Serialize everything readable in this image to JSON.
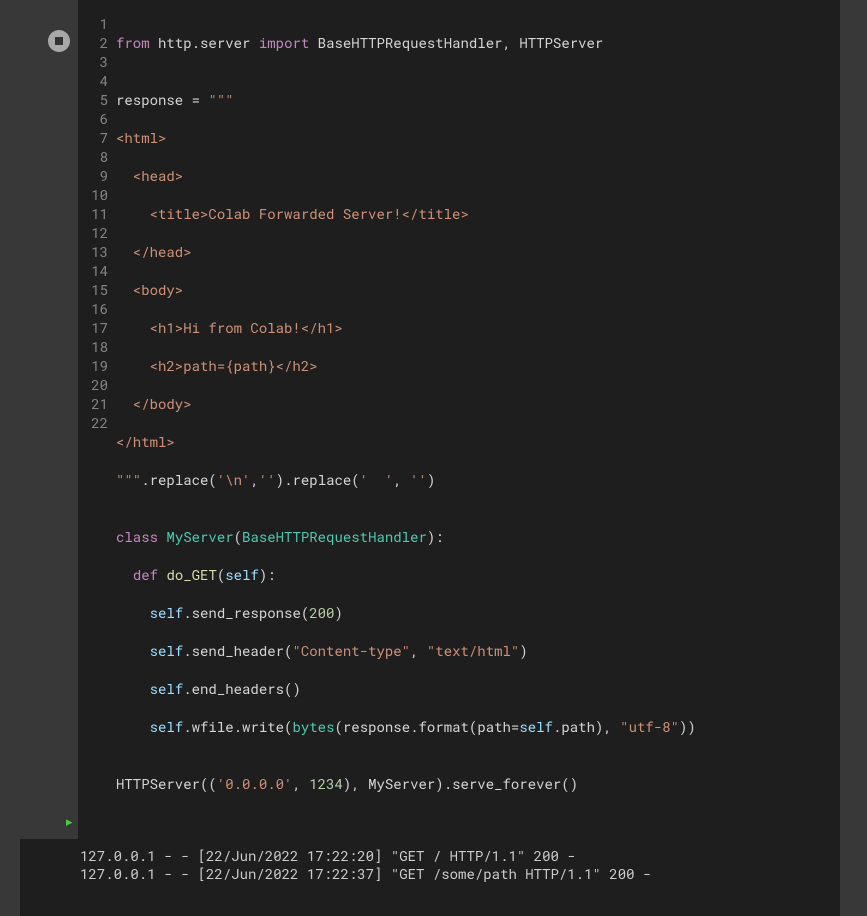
{
  "line_numbers": [
    "1",
    "2",
    "3",
    "4",
    "5",
    "6",
    "7",
    "8",
    "9",
    "10",
    "11",
    "12",
    "13",
    "14",
    "15",
    "16",
    "17",
    "18",
    "19",
    "20",
    "21",
    "22"
  ],
  "code": {
    "l1": {
      "from": "from",
      "http": "http",
      "dot": ".",
      "server": "server",
      "import": "import",
      "names": " BaseHTTPRequestHandler, HTTPServer"
    },
    "l2": "",
    "l3": {
      "response": "response ",
      "eq": "= ",
      "q": "\"\"\""
    },
    "l4": "<html>",
    "l5": "  <head>",
    "l6": "    <title>Colab Forwarded Server!</title>",
    "l7": "  </head>",
    "l8": "  <body>",
    "l9": "    <h1>Hi from Colab!</h1>",
    "l10": "    <h2>path={path}</h2>",
    "l11": "  </body>",
    "l12": "</html>",
    "l13": {
      "q": "\"\"\"",
      "dot1": ".",
      "replace1": "replace(",
      "nl": "'\\n'",
      "c1": ",",
      "e1": "''",
      "close1": ").",
      "replace2": "replace(",
      "sp": "'  '",
      "c2": ", ",
      "e2": "''",
      "close2": ")"
    },
    "l14": "",
    "l15": {
      "class": "class",
      "sp": " ",
      "name": "MyServer",
      "p1": "(",
      "base": "BaseHTTPRequestHandler",
      "p2": "):"
    },
    "l16": {
      "indent": "  ",
      "def": "def",
      "sp": " ",
      "name": "do_GET",
      "p1": "(",
      "self": "self",
      "p2": "):"
    },
    "l17": {
      "indent": "    ",
      "self": "self",
      "dot": ".",
      "call": "send_response(",
      "num": "200",
      "close": ")"
    },
    "l18": {
      "indent": "    ",
      "self": "self",
      "dot": ".",
      "call": "send_header(",
      "s1": "\"Content-type\"",
      "c": ", ",
      "s2": "\"text/html\"",
      "close": ")"
    },
    "l19": {
      "indent": "    ",
      "self": "self",
      "dot": ".",
      "call": "end_headers()"
    },
    "l20": {
      "indent": "    ",
      "self": "self",
      "dot1": ".",
      "wfile": "wfile",
      "dot2": ".",
      "write": "write(",
      "bytes": "bytes",
      "p1": "(response",
      "dot3": ".",
      "format": "format(path=",
      "self2": "self",
      "dot4": ".",
      "path": "path), ",
      "utf": "\"utf-8\"",
      "close": "))"
    },
    "l21": "",
    "l22": {
      "h": "HTTPServer((",
      "ip": "'0.0.0.0'",
      "c": ", ",
      "port": "1234",
      "rest": "), MyServer).serve_forever()"
    }
  },
  "output_lines": [
    "127.0.0.1 - - [22/Jun/2022 17:22:20] \"GET / HTTP/1.1\" 200 -",
    "127.0.0.1 - - [22/Jun/2022 17:22:37] \"GET /some/path HTTP/1.1\" 200 -"
  ],
  "arrow": "▸"
}
